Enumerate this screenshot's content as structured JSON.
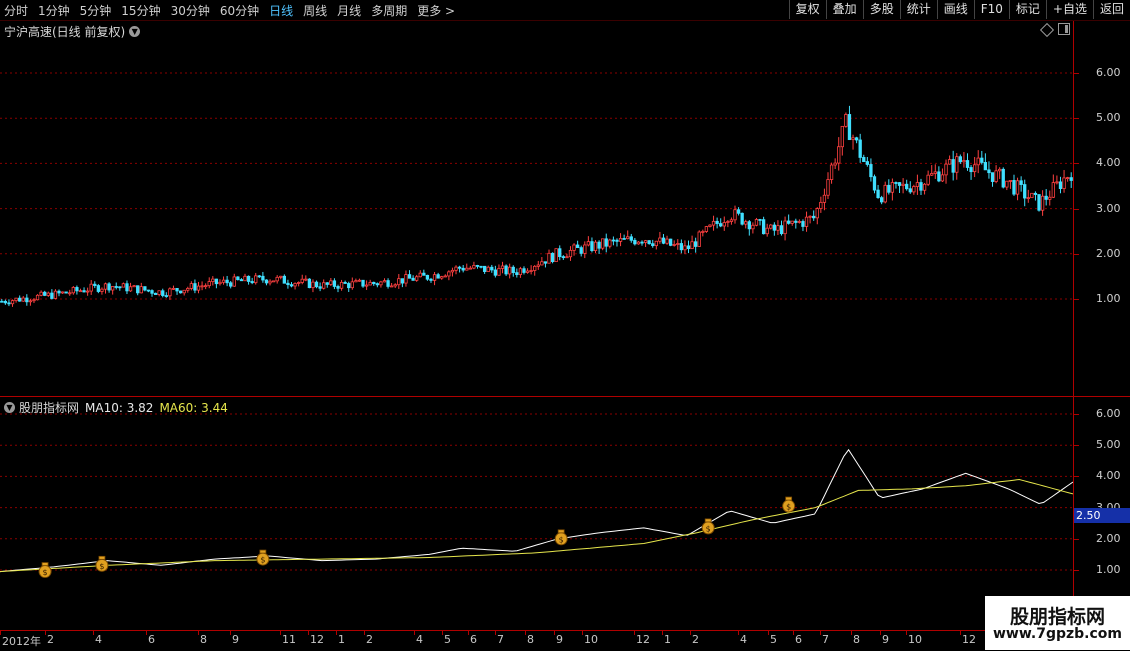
{
  "toolbar": {
    "periods": [
      "分时",
      "1分钟",
      "5分钟",
      "15分钟",
      "30分钟",
      "60分钟",
      "日线",
      "周线",
      "月线",
      "多周期",
      "更多 >"
    ],
    "active_period": "日线",
    "buttons": [
      "复权",
      "叠加",
      "多股",
      "统计",
      "画线",
      "F10",
      "标记",
      "+自选",
      "返回"
    ]
  },
  "main_pane": {
    "title": "宁沪高速(日线 前复权)",
    "y_ticks": [
      "6.00",
      "5.00",
      "4.00",
      "3.00",
      "2.00",
      "1.00"
    ]
  },
  "indicator_pane": {
    "name": "股朋指标网",
    "ma10_label": "MA10: 3.82",
    "ma60_label": "MA60: 3.44",
    "y_ticks": [
      "6.00",
      "5.00",
      "4.00",
      "3.00",
      "2.00",
      "1.00"
    ],
    "cursor_value": "2.50"
  },
  "x_axis": {
    "labels": [
      "2012年",
      "2",
      "4",
      "6",
      "8",
      "9",
      "11",
      "12",
      "1",
      "2",
      "4",
      "5",
      "6",
      "7",
      "8",
      "9",
      "10",
      "12",
      "1",
      "2",
      "4",
      "5",
      "6",
      "7",
      "8",
      "9",
      "10",
      "12"
    ]
  },
  "watermark": {
    "line1": "股朋指标网",
    "line2": "www.7gpzb.com"
  },
  "colors": {
    "up_candle": "#ff4040",
    "down_candle": "#40e0ff",
    "white_line": "#ffffff",
    "ma_line": "#e6e64c",
    "grid": "#8a0000",
    "axis_border": "#b00000"
  },
  "chart_data": {
    "type": "line",
    "series": [
      {
        "name": "MA10",
        "x": [
          0.0,
          0.05,
          0.1,
          0.15,
          0.2,
          0.25,
          0.3,
          0.35,
          0.4,
          0.43,
          0.48,
          0.52,
          0.56,
          0.6,
          0.64,
          0.68,
          0.72,
          0.76,
          0.79,
          0.82,
          0.86,
          0.9,
          0.94,
          0.97,
          1.0
        ],
        "values": [
          0.95,
          1.1,
          1.3,
          1.15,
          1.35,
          1.45,
          1.3,
          1.35,
          1.5,
          1.7,
          1.6,
          2.0,
          2.2,
          2.35,
          2.1,
          2.9,
          2.5,
          2.8,
          4.9,
          3.3,
          3.6,
          4.1,
          3.6,
          3.1,
          3.82
        ]
      },
      {
        "name": "MA60",
        "x": [
          0.0,
          0.1,
          0.2,
          0.3,
          0.4,
          0.5,
          0.6,
          0.65,
          0.7,
          0.76,
          0.8,
          0.85,
          0.9,
          0.95,
          1.0
        ],
        "values": [
          0.95,
          1.15,
          1.3,
          1.35,
          1.4,
          1.55,
          1.85,
          2.2,
          2.6,
          3.0,
          3.55,
          3.6,
          3.7,
          3.9,
          3.44
        ]
      }
    ],
    "ylim": [
      0.7,
      6.3
    ]
  }
}
